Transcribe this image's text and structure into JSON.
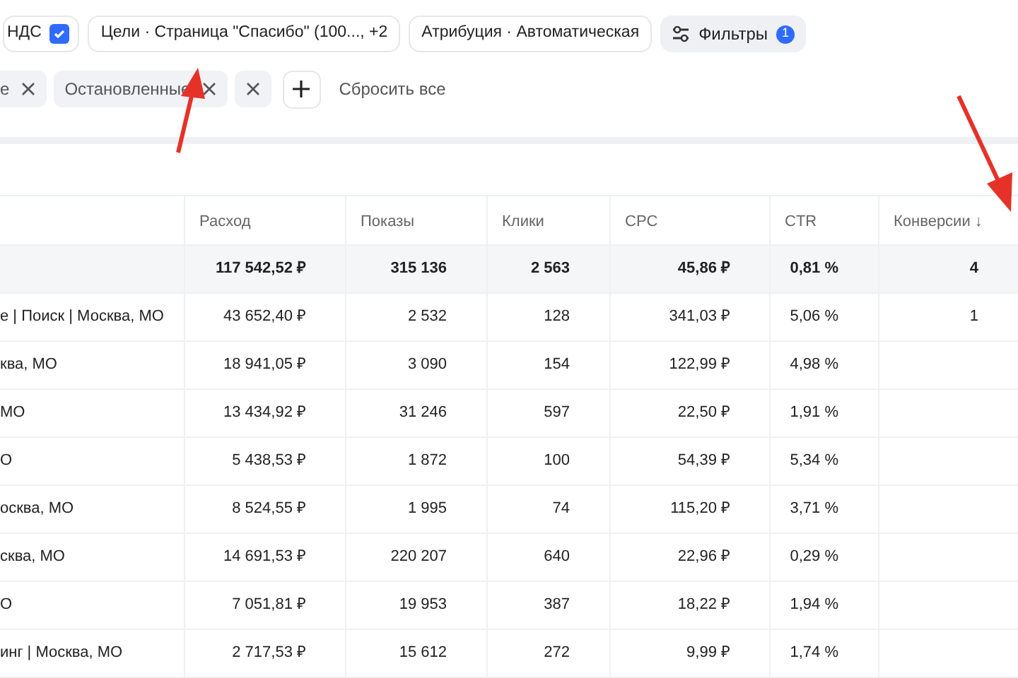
{
  "toolbar": {
    "vat_chip": {
      "label": "НДС",
      "checked": true
    },
    "chips": [
      "Цели · Страница \"Спасибо\" (100..., +2",
      "Атрибуция · Автоматическая"
    ],
    "filters_button": {
      "label": "Фильтры",
      "badge": "1"
    }
  },
  "filter_tags": [
    {
      "kind": "tag",
      "label": "е"
    },
    {
      "kind": "tag",
      "label": "Остановленные"
    },
    {
      "kind": "clear"
    }
  ],
  "reset_label": "Сбросить все",
  "table": {
    "columns": [
      "Расход",
      "Показы",
      "Клики",
      "CPC",
      "CTR",
      "Конверсии ↓"
    ],
    "totals": [
      "117 542,52 ₽",
      "315 136",
      "2 563",
      "45,86 ₽",
      "0,81 %",
      "4"
    ],
    "rows": [
      {
        "campaign": "е | Поиск | Москва, МО",
        "values": [
          "43 652,40 ₽",
          "2 532",
          "128",
          "341,03 ₽",
          "5,06 %",
          "1"
        ]
      },
      {
        "campaign": "ква, МО",
        "values": [
          "18 941,05 ₽",
          "3 090",
          "154",
          "122,99 ₽",
          "4,98 %"
        ]
      },
      {
        "campaign": "МО",
        "values": [
          "13 434,92 ₽",
          "31 246",
          "597",
          "22,50 ₽",
          "1,91 %"
        ]
      },
      {
        "campaign": "О",
        "values": [
          "5 438,53 ₽",
          "1 872",
          "100",
          "54,39 ₽",
          "5,34 %"
        ]
      },
      {
        "campaign": "осква, МО",
        "values": [
          "8 524,55 ₽",
          "1 995",
          "74",
          "115,20 ₽",
          "3,71 %"
        ]
      },
      {
        "campaign": "сква, МО",
        "values": [
          "14 691,53 ₽",
          "220 207",
          "640",
          "22,96 ₽",
          "0,29 %"
        ]
      },
      {
        "campaign": "О",
        "values": [
          "7 051,81 ₽",
          "19 953",
          "387",
          "18,22 ₽",
          "1,94 %"
        ]
      },
      {
        "campaign": "инг | Москва, МО",
        "values": [
          "2 717,53 ₽",
          "15 612",
          "272",
          "9,99 ₽",
          "1,74 %"
        ]
      }
    ]
  }
}
